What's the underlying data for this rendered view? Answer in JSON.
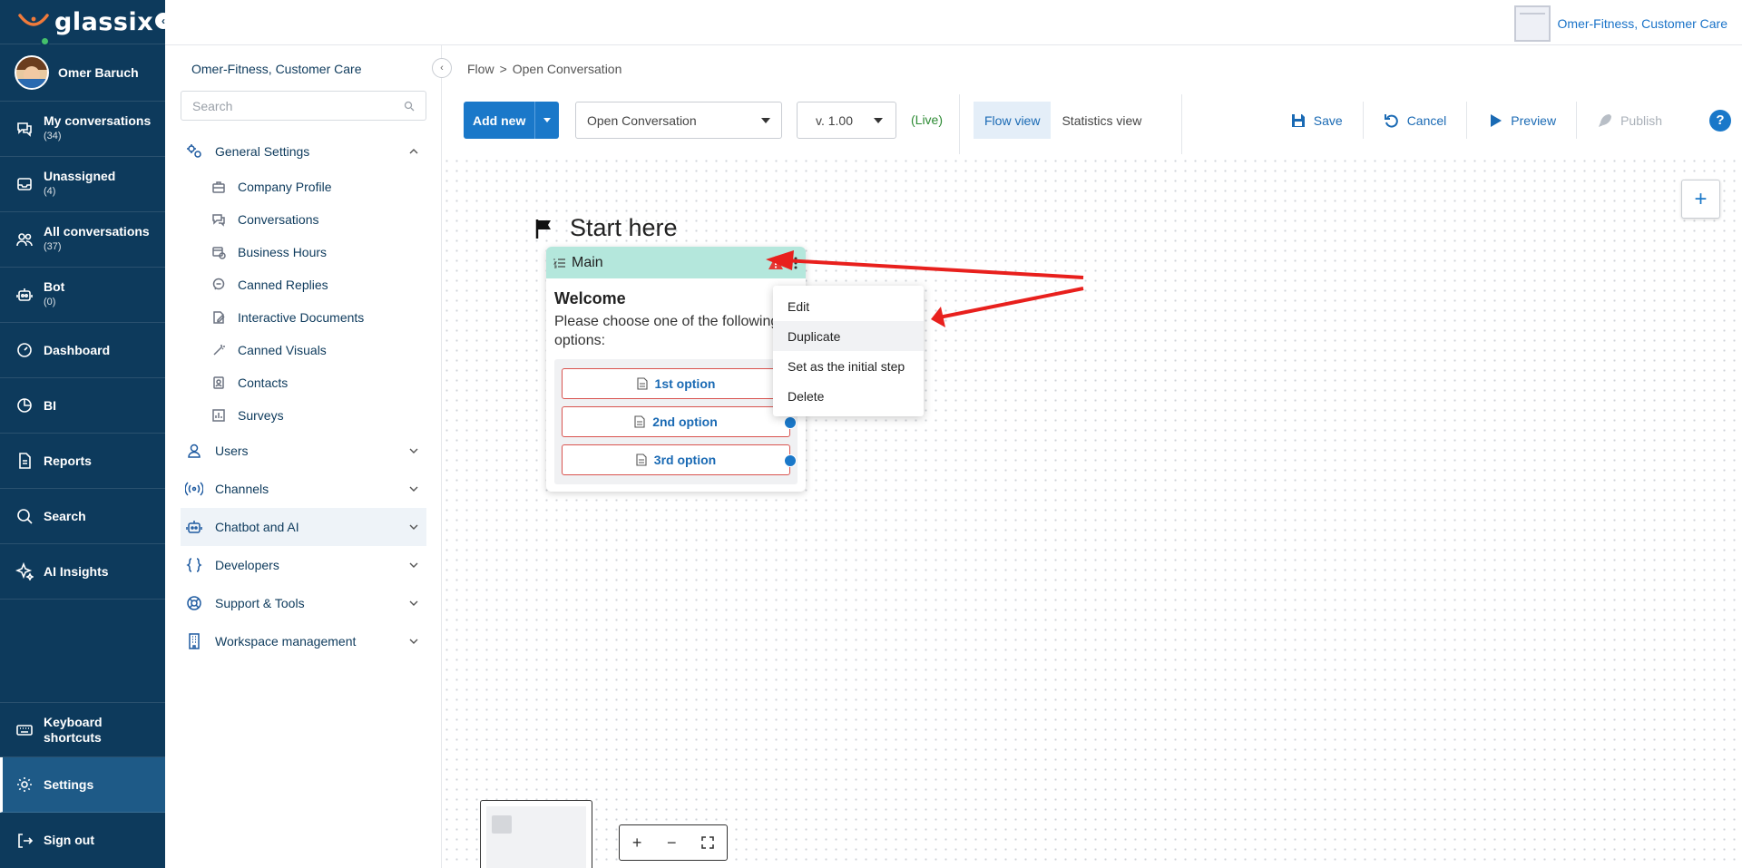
{
  "app": {
    "brand": "glassix"
  },
  "user": {
    "name": "Omer Baruch"
  },
  "org": {
    "name": "Omer-Fitness, Customer Care"
  },
  "leftnav": {
    "items": [
      {
        "label": "My conversations",
        "count": "(34)",
        "icon": "chat-icon"
      },
      {
        "label": "Unassigned",
        "count": "(4)",
        "icon": "inbox-icon"
      },
      {
        "label": "All conversations",
        "count": "(37)",
        "icon": "users-icon"
      },
      {
        "label": "Bot",
        "count": "(0)",
        "icon": "robot-icon"
      },
      {
        "label": "Dashboard",
        "icon": "gauge-icon"
      },
      {
        "label": "BI",
        "icon": "pie-chart-icon"
      },
      {
        "label": "Reports",
        "icon": "document-icon"
      },
      {
        "label": "Search",
        "icon": "search-icon"
      },
      {
        "label": "AI Insights",
        "icon": "sparkle-icon"
      }
    ],
    "bottom": [
      {
        "label": "Keyboard shortcuts",
        "icon": "keyboard-icon"
      },
      {
        "label": "Settings",
        "icon": "gear-icon"
      },
      {
        "label": "Sign out",
        "icon": "sign-out-icon"
      }
    ]
  },
  "settings": {
    "org": "Omer-Fitness, Customer Care",
    "search_placeholder": "Search",
    "general": "General Settings",
    "sub_items": [
      "Company Profile",
      "Conversations",
      "Business Hours",
      "Canned Replies",
      "Interactive Documents",
      "Canned Visuals",
      "Contacts",
      "Surveys"
    ],
    "sections": [
      "Users",
      "Channels",
      "Chatbot and AI",
      "Developers",
      "Support & Tools",
      "Workspace management"
    ]
  },
  "breadcrumb": {
    "root": "Flow",
    "sep": ">",
    "current": "Open Conversation"
  },
  "toolbar": {
    "add_new": "Add new",
    "flow_select": "Open Conversation",
    "version": "v. 1.00",
    "live": "(Live)",
    "flow_view": "Flow view",
    "stats_view": "Statistics view",
    "save": "Save",
    "cancel": "Cancel",
    "preview": "Preview",
    "publish": "Publish",
    "help": "?"
  },
  "canvas": {
    "start": "Start here",
    "node": {
      "title": "Main",
      "heading": "Welcome",
      "text_line1": "Please choose one of the following",
      "text_line2": "options:",
      "options": [
        "1st option",
        "2nd option",
        "3rd option"
      ]
    },
    "context_menu": [
      "Edit",
      "Duplicate",
      "Set as the initial step",
      "Delete"
    ]
  },
  "colors": {
    "nav_bg": "#0d3a5c",
    "accent": "#1a78c9",
    "node_header": "#b4e7dc",
    "option_border": "#d9534f",
    "live": "#2e8b35",
    "annotation_arrow": "#e8201d"
  }
}
